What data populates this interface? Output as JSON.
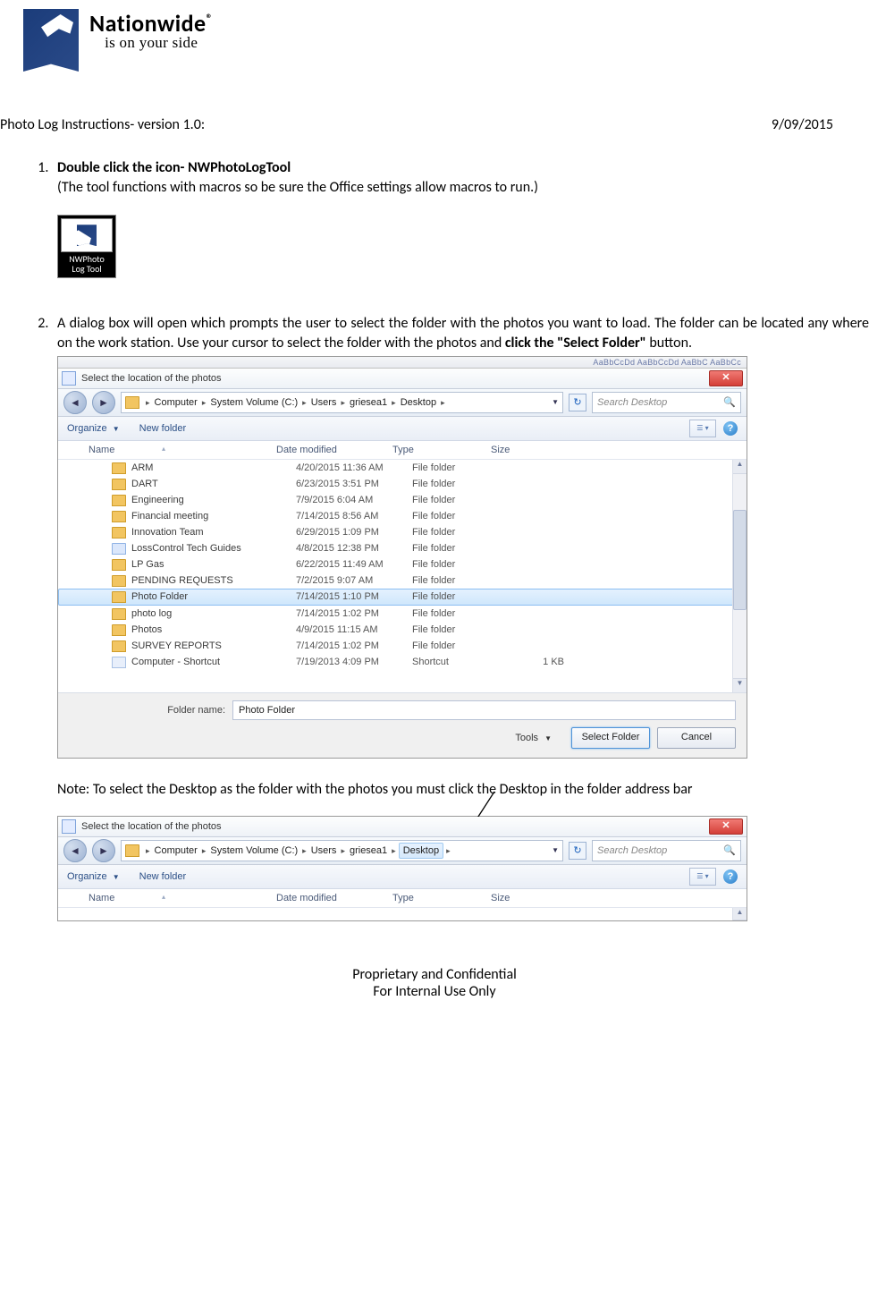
{
  "brand": {
    "name": "Nationwide",
    "reg": "®",
    "tagline": "is on your side"
  },
  "header": {
    "title": "Photo Log Instructions- version 1.0:",
    "date": "9/09/2015"
  },
  "steps": {
    "s1": {
      "bold": "Double click the icon- NWPhotoLogTool",
      "para": "(The tool functions with macros so be sure the Office settings allow macros to run.)",
      "icon_line1": "NWPhoto",
      "icon_line2": "Log Tool"
    },
    "s2": {
      "intro_a": "A dialog box will open which prompts the user to select the folder with the photos you want to load.  The folder can be located any where on the work station.  Use your cursor to select the folder with the photos and ",
      "intro_bold": "click the \"Select Folder\"",
      "intro_b": " button.",
      "note": "Note:  To select the Desktop as the folder with the photos you must click the Desktop in the folder address bar"
    }
  },
  "dialog": {
    "style_strip": "AaBbCcDd  AaBbCcDd  AaBbC  AaBbCc",
    "title": "Select the location of the photos",
    "breadcrumb": [
      "Computer",
      "System Volume (C:)",
      "Users",
      "griesea1",
      "Desktop"
    ],
    "search_placeholder": "Search Desktop",
    "toolbar": {
      "organize": "Organize",
      "newfolder": "New folder"
    },
    "columns": {
      "name": "Name",
      "date": "Date modified",
      "type": "Type",
      "size": "Size"
    },
    "rows": [
      {
        "name": "ARM",
        "date": "4/20/2015 11:36 AM",
        "type": "File folder",
        "size": "",
        "kind": "folder"
      },
      {
        "name": "DART",
        "date": "6/23/2015 3:51 PM",
        "type": "File folder",
        "size": "",
        "kind": "folder"
      },
      {
        "name": "Engineering",
        "date": "7/9/2015 6:04 AM",
        "type": "File folder",
        "size": "",
        "kind": "folder"
      },
      {
        "name": "Financial meeting",
        "date": "7/14/2015 8:56 AM",
        "type": "File folder",
        "size": "",
        "kind": "folder"
      },
      {
        "name": "Innovation Team",
        "date": "6/29/2015 1:09 PM",
        "type": "File folder",
        "size": "",
        "kind": "folder"
      },
      {
        "name": "LossControl Tech Guides",
        "date": "4/8/2015 12:38 PM",
        "type": "File folder",
        "size": "",
        "kind": "link"
      },
      {
        "name": "LP Gas",
        "date": "6/22/2015 11:49 AM",
        "type": "File folder",
        "size": "",
        "kind": "folder"
      },
      {
        "name": "PENDING REQUESTS",
        "date": "7/2/2015 9:07 AM",
        "type": "File folder",
        "size": "",
        "kind": "folder"
      },
      {
        "name": "Photo Folder",
        "date": "7/14/2015 1:10 PM",
        "type": "File folder",
        "size": "",
        "kind": "folder",
        "selected": true
      },
      {
        "name": "photo log",
        "date": "7/14/2015 1:02 PM",
        "type": "File folder",
        "size": "",
        "kind": "folder"
      },
      {
        "name": "Photos",
        "date": "4/9/2015 11:15 AM",
        "type": "File folder",
        "size": "",
        "kind": "folder"
      },
      {
        "name": "SURVEY REPORTS",
        "date": "7/14/2015 1:02 PM",
        "type": "File folder",
        "size": "",
        "kind": "folder"
      },
      {
        "name": "Computer - Shortcut",
        "date": "7/19/2013 4:09 PM",
        "type": "Shortcut",
        "size": "1 KB",
        "kind": "shortcut"
      }
    ],
    "folder_name_label": "Folder name:",
    "folder_name_value": "Photo Folder",
    "tools": "Tools",
    "select_btn": "Select Folder",
    "cancel_btn": "Cancel"
  },
  "footer": {
    "line1": "Proprietary and Confidential",
    "line2": "For Internal Use Only"
  }
}
